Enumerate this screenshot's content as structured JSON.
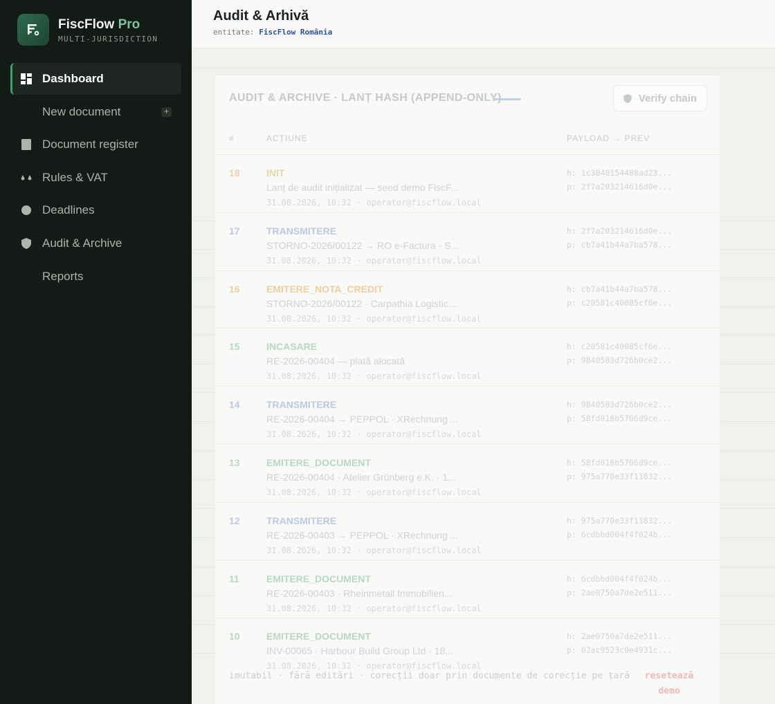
{
  "brand": {
    "name": "FiscFlow",
    "pro": "Pro",
    "subtitle": "MULTI-JURISDICTION"
  },
  "sidebar": {
    "items": [
      {
        "label": "Dashboard",
        "icon": "dashboard-icon",
        "active": true
      },
      {
        "label": "New document",
        "icon": "",
        "badge": "+"
      },
      {
        "label": "Document register",
        "icon": "document-icon"
      },
      {
        "label": "Rules & VAT",
        "icon": "dots-icon"
      },
      {
        "label": "Deadlines",
        "icon": "circle-icon"
      },
      {
        "label": "Audit & Archive",
        "icon": "shield-icon"
      },
      {
        "label": "Reports",
        "icon": ""
      }
    ]
  },
  "header": {
    "title": "Audit & Arhivă",
    "entity_label": "entitate:",
    "entity": "FiscFlow România"
  },
  "card": {
    "title": "AUDIT & ARCHIVE · LANȚ HASH (APPEND-ONLY)",
    "verify_label": "Verify chain",
    "columns": {
      "num": "#",
      "action": "ACȚIUNE",
      "payload": "PAYLOAD → PREV"
    }
  },
  "colors": {
    "sidebar_bg": "#121b16",
    "accent": "#3fa06e",
    "init": "#e9d5a8",
    "transmit": "#bcc9e5",
    "credit_note": "#eecfa0",
    "collect": "#b8d8c5",
    "issue": "#b8d8c5",
    "reset": "#f0b8b8"
  },
  "entries": [
    {
      "num": "18",
      "action": "INIT",
      "color": "#e9d5a8",
      "desc": "Lanț de audit inițializat — seed demo FiscF...",
      "meta": "31.08.2026, 10:32 · operator@fiscflow.local",
      "h": "h: 1c3840154488ad23...",
      "p": "p: 2f7a203214616d0e..."
    },
    {
      "num": "17",
      "action": "TRANSMITERE",
      "color": "#bcc9e5",
      "desc": "STORNO-2026/00122 → RO e-Factura · S...",
      "meta": "31.08.2026, 10:32 · operator@fiscflow.local",
      "h": "h: 2f7a203214616d0e...",
      "p": "p: cb7a41b44a7ba578..."
    },
    {
      "num": "16",
      "action": "EMITERE_NOTA_CREDIT",
      "color": "#eecfa0",
      "desc": "STORNO-2026/00122 · Carpathia Logistic...",
      "meta": "31.08.2026, 10:32 · operator@fiscflow.local",
      "h": "h: cb7a41b44a7ba578...",
      "p": "p: c20581c40085cf6e..."
    },
    {
      "num": "15",
      "action": "INCASARE",
      "color": "#b8d8c5",
      "desc": "RE-2026-00404 — plată alocată",
      "meta": "31.08.2026, 10:32 · operator@fiscflow.local",
      "h": "h: c20581c40085cf6e...",
      "p": "p: 9840583d726b0ce2..."
    },
    {
      "num": "14",
      "action": "TRANSMITERE",
      "color": "#bcc9e5",
      "desc": "RE-2026-00404 → PEPPOL · XRechnung ...",
      "meta": "31.08.2026, 10:32 · operator@fiscflow.local",
      "h": "h: 9840583d726b0ce2...",
      "p": "p: 58fd018b5706d9ce..."
    },
    {
      "num": "13",
      "action": "EMITERE_DOCUMENT",
      "color": "#b8d8c5",
      "desc": "RE-2026-00404 · Atelier Grünberg e.K. · 1...",
      "meta": "31.08.2026, 10:32 · operator@fiscflow.local",
      "h": "h: 58fd018b5706d9ce...",
      "p": "p: 975a770e33f11832..."
    },
    {
      "num": "12",
      "action": "TRANSMITERE",
      "color": "#bcc9e5",
      "desc": "RE-2026-00403 → PEPPOL · XRechnung ...",
      "meta": "31.08.2026, 10:32 · operator@fiscflow.local",
      "h": "h: 975a770e33f11832...",
      "p": "p: 6cdbbd004f4f024b..."
    },
    {
      "num": "11",
      "action": "EMITERE_DOCUMENT",
      "color": "#b8d8c5",
      "desc": "RE-2026-00403 · Rheinmetall Immobilien...",
      "meta": "31.08.2026, 10:32 · operator@fiscflow.local",
      "h": "h: 6cdbbd004f4f024b...",
      "p": "p: 2ae0750a7de2e511..."
    },
    {
      "num": "10",
      "action": "EMITERE_DOCUMENT",
      "color": "#b8d8c5",
      "desc": "INV-00065 · Harbour Build Group Ltd · 18...",
      "meta": "31.08.2026, 10:32 · operator@fiscflow.local",
      "h": "h: 2ae0750a7de2e511...",
      "p": "p: 02ac9523c0e4931c..."
    }
  ],
  "footer": {
    "note": "imutabil · fără editări · corecții doar prin documente de corecție pe țară",
    "reset": "resetează demo"
  }
}
